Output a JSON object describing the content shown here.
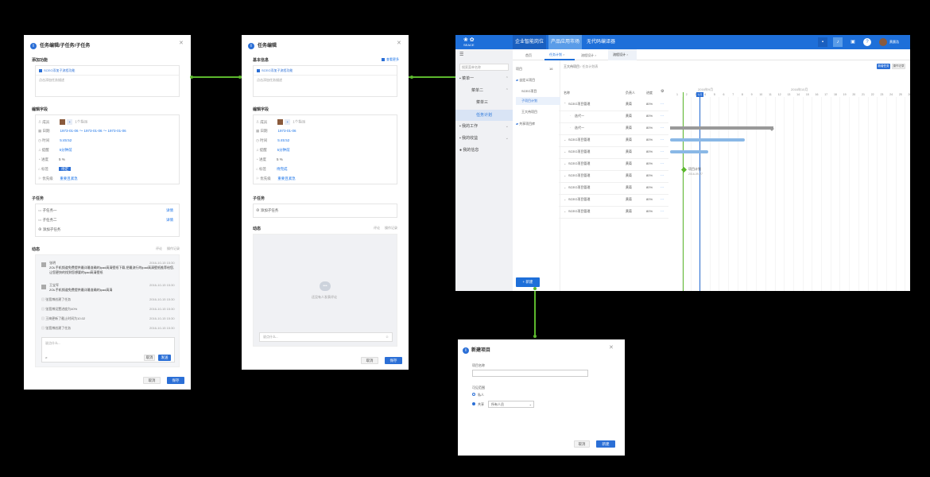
{
  "dialog1": {
    "title": "任务编辑/子任务/子任务",
    "sec_add": "添加功能",
    "add_item": "SCEO添加子流程功能",
    "add_placeholder": "点击添加任务描述",
    "sec_edit": "编辑字段",
    "fields": [
      {
        "label": "成员",
        "value": "1个指派"
      },
      {
        "label": "日期",
        "value": "1973-01-06 ～ 1973-01-06 ～ 1973-01-06"
      },
      {
        "label": "时间",
        "value": "5:45:52"
      },
      {
        "label": "提醒",
        "value": "5分钟前"
      },
      {
        "label": "进度",
        "value": "5 %"
      },
      {
        "label": "标签",
        "value": "待定"
      },
      {
        "label": "优先级",
        "value": "重要且紧急"
      }
    ],
    "sec_sub": "子任务",
    "subtasks": [
      {
        "name": "子任务一",
        "action": "详情"
      },
      {
        "name": "子任务二",
        "action": "详情"
      }
    ],
    "add_sub": "添加子任务",
    "sec_activity": "动态",
    "activity_tabs": [
      "评论",
      "操作记录"
    ],
    "comments": [
      {
        "user": "张明",
        "text": "ZOL手机频道免费提供最详最准确的ipad高清壁纸下载,把最流行的ipad高清壁纸推荐给您,让您更快的找到您想要的ipad高清壁纸",
        "time": "2016-10-15 15:30"
      },
      {
        "user": "王宝军",
        "text": "ZOL手机频道免费提供最详最准确的ipad高清",
        "time": "2016-10-15 15:30"
      }
    ],
    "logs": [
      {
        "text": "张宽博创建了任务",
        "time": "2016-10-15 15:30"
      },
      {
        "text": "张宽博设置进度为40%",
        "time": "2016-10-15 15:30"
      },
      {
        "text": "王梅更新了截止时间为10.02",
        "time": "2016-10-15 15:30"
      },
      {
        "text": "张宽博创建了任务",
        "time": "2016-10-15 15:30"
      }
    ],
    "comment_placeholder": "说点什么...",
    "comment_cancel": "取消",
    "comment_send": "发送",
    "cancel": "取消",
    "save": "保存"
  },
  "dialog2": {
    "title": "任务编辑",
    "sec_base": "基本信息",
    "view_more": "查看更多",
    "add_item": "SCEO添加子流程功能",
    "add_placeholder": "点击添加任务描述",
    "sec_edit": "编辑字段",
    "fields": [
      {
        "label": "成员",
        "value": "1个指派"
      },
      {
        "label": "日期",
        "value": "1973-01-06"
      },
      {
        "label": "时间",
        "value": "5:45:52"
      },
      {
        "label": "提醒",
        "value": "5分钟前"
      },
      {
        "label": "进度",
        "value": "5 %"
      },
      {
        "label": "标签",
        "value": "待完成"
      },
      {
        "label": "优先级",
        "value": "重要且紧急"
      }
    ],
    "sec_sub": "子任务",
    "add_sub": "添加子任务",
    "sec_activity": "动态",
    "activity_tabs": [
      "评论",
      "操作记录"
    ],
    "empty_text": "还没有人发表评论",
    "comment_placeholder": "说点什么...",
    "cancel": "取消",
    "save": "保存"
  },
  "app": {
    "logo_text": "SEACE",
    "top_tabs": [
      "企业智能岗位",
      "产品应用市场",
      "无代码编译器"
    ],
    "user_name": "黄晨浩",
    "search_placeholder": "搜索菜单名称",
    "menu": [
      {
        "label": "菜单一"
      },
      {
        "label": "菜单二"
      },
      {
        "label": "菜单三"
      },
      {
        "label": "任务计划"
      },
      {
        "label": "我的工作"
      },
      {
        "label": "我的收益"
      },
      {
        "label": "我的信息"
      }
    ],
    "page_tabs": [
      "首页",
      "任务计划",
      "流程设计",
      "流程设计"
    ],
    "project_label": "项目",
    "project_count": "16",
    "project_list": [
      "自定义项目",
      "SCEO项目",
      "子项目计划",
      "王大伟项目",
      "共享项目库"
    ],
    "breadcrumb": [
      "王大伟项目",
      "任务计划表"
    ],
    "btn_primary": "新增任务",
    "btn_secondary": "操作记录",
    "new_btn": "+ 新建",
    "table_headers": [
      "名称",
      "负责人",
      "进度"
    ],
    "rows": [
      {
        "name": "SCEO项目管理",
        "owner": "黄菊",
        "progress": "80%"
      },
      {
        "name": "迭代一",
        "owner": "黄菊",
        "progress": "80%"
      },
      {
        "name": "迭代一",
        "owner": "黄菊",
        "progress": "80%"
      },
      {
        "name": "SCEO项目管理",
        "owner": "黄菊",
        "progress": "80%"
      },
      {
        "name": "SCEO项目管理",
        "owner": "黄菊",
        "progress": "80%"
      },
      {
        "name": "SCEO项目管理",
        "owner": "黄菊",
        "progress": "80%"
      },
      {
        "name": "SCEO项目管理",
        "owner": "黄菊",
        "progress": "80%"
      },
      {
        "name": "SCEO项目管理",
        "owner": "黄菊",
        "progress": "80%"
      },
      {
        "name": "SCEO项目管理",
        "owner": "黄菊",
        "progress": "80%"
      },
      {
        "name": "SCEO项目管理",
        "owner": "黄菊",
        "progress": "80%"
      }
    ],
    "months": [
      "2016年9月",
      "2016年10月"
    ],
    "days": [
      "1",
      "2",
      "3",
      "4",
      "5",
      "6",
      "7",
      "8",
      "9",
      "10",
      "11",
      "12",
      "13",
      "14",
      "15",
      "16",
      "17",
      "18",
      "19",
      "20",
      "21",
      "22",
      "23",
      "24",
      "25",
      "26"
    ],
    "today_label": "今天",
    "milestone_label": "项目计划",
    "milestone_date": "2016-09-27"
  },
  "dialog3": {
    "title": "新建项目",
    "name_label": "项目名称",
    "visibility_label": "可见范围",
    "opt_private": "私人",
    "opt_share": "共享",
    "share_value": "所有人员",
    "cancel": "取消",
    "ok": "新建"
  }
}
